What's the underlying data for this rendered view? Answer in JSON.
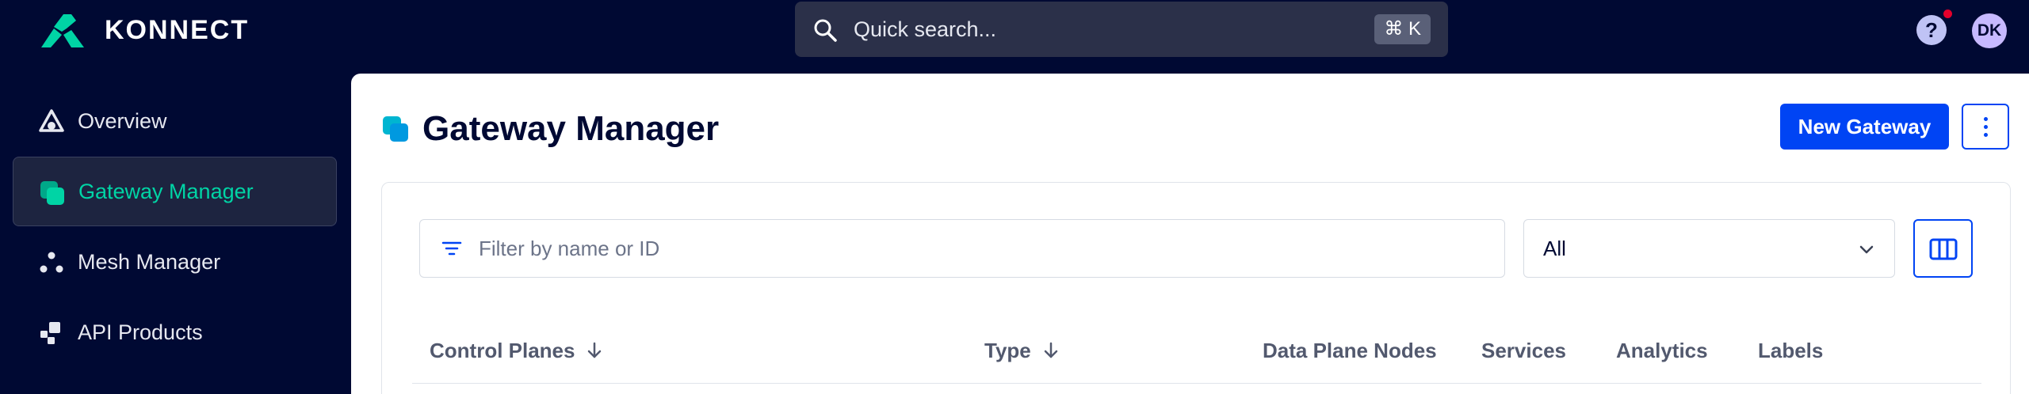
{
  "app": {
    "logo_text": "KONNECT"
  },
  "search": {
    "placeholder": "Quick search...",
    "shortcut": "⌘ K"
  },
  "topbar": {
    "help_label": "?",
    "avatar_initials": "DK",
    "notification_color": "#e4002b"
  },
  "sidebar": {
    "items": [
      {
        "label": "Overview",
        "icon": "overview-icon",
        "active": false
      },
      {
        "label": "Gateway Manager",
        "icon": "gateway-icon",
        "active": true
      },
      {
        "label": "Mesh Manager",
        "icon": "mesh-icon",
        "active": false
      },
      {
        "label": "API Products",
        "icon": "api-products-icon",
        "active": false
      }
    ]
  },
  "page": {
    "title": "Gateway Manager"
  },
  "actions": {
    "new_gateway": "New Gateway"
  },
  "filter": {
    "placeholder": "Filter by name or ID",
    "type_selected": "All"
  },
  "table": {
    "columns": [
      {
        "label": "Control Planes",
        "sortable": true
      },
      {
        "label": "Type",
        "sortable": true
      },
      {
        "label": "Data Plane Nodes",
        "sortable": false
      },
      {
        "label": "Services",
        "sortable": false
      },
      {
        "label": "Analytics",
        "sortable": false
      },
      {
        "label": "Labels",
        "sortable": false
      }
    ]
  },
  "colors": {
    "accent": "#0044f4",
    "brand_teal": "#00d4a5",
    "background": "#000933"
  }
}
